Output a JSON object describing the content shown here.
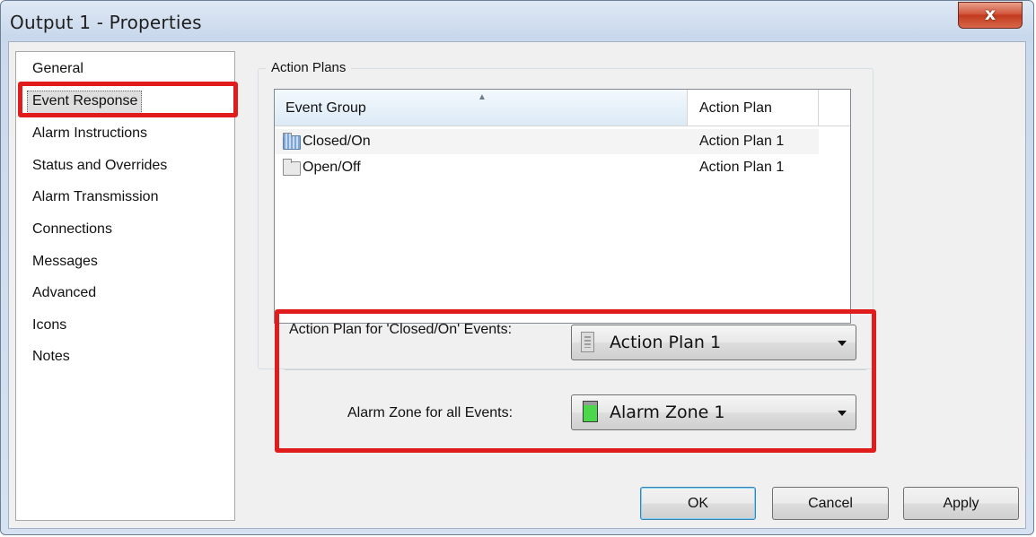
{
  "window": {
    "title": "Output 1 - Properties",
    "close_glyph": "x"
  },
  "sidebar": {
    "selected_index": 1,
    "items": [
      {
        "label": "General"
      },
      {
        "label": "Event Response"
      },
      {
        "label": "Alarm Instructions"
      },
      {
        "label": "Status and Overrides"
      },
      {
        "label": "Alarm Transmission"
      },
      {
        "label": "Connections"
      },
      {
        "label": "Messages"
      },
      {
        "label": "Advanced"
      },
      {
        "label": "Icons"
      },
      {
        "label": "Notes"
      }
    ]
  },
  "action_plans": {
    "group_label": "Action Plans",
    "columns": [
      {
        "label": "Event Group",
        "sorted": "ascending"
      },
      {
        "label": "Action Plan"
      }
    ],
    "rows": [
      {
        "event_group": "Closed/On",
        "action_plan": "Action Plan 1",
        "icon": "folder-blue-icon",
        "selected": true
      },
      {
        "event_group": "Open/Off",
        "action_plan": "Action Plan 1",
        "icon": "folder-icon",
        "selected": false
      }
    ]
  },
  "fields": {
    "action_plan": {
      "label": "Action Plan for 'Closed/On' Events:",
      "value": "Action Plan 1",
      "icon": "action-plan-icon"
    },
    "alarm_zone": {
      "label": "Alarm Zone for all Events:",
      "value": "Alarm Zone 1",
      "icon": "alarm-zone-icon"
    }
  },
  "buttons": {
    "ok": "OK",
    "cancel": "Cancel",
    "apply": "Apply"
  },
  "colors": {
    "highlight_red": "#e01c1c",
    "alarm_zone_green": "#4cd64c",
    "close_button_red": "#c23a1e"
  }
}
